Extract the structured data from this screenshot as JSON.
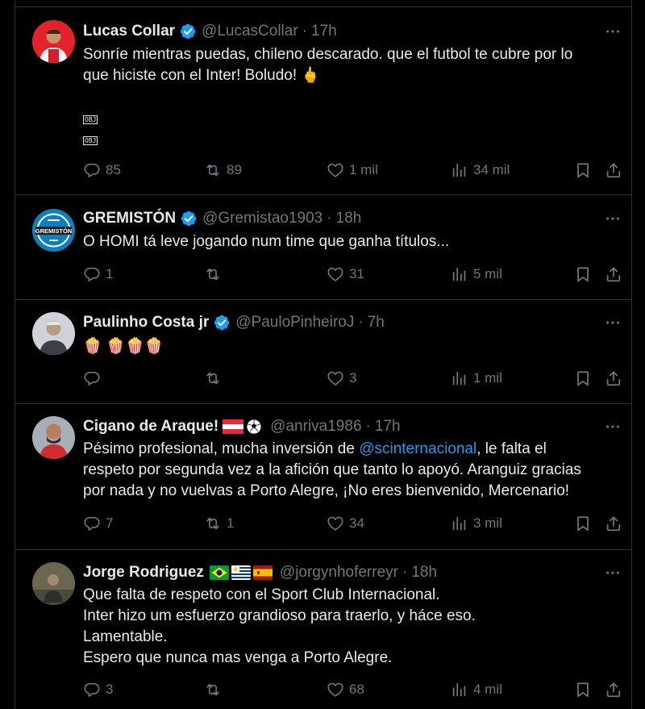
{
  "tweets": [
    {
      "name": "Lucas Collar",
      "handle": "@LucasCollar",
      "time": "17h",
      "lines": [
        "Sonríe mientras puedas, chileno descarado. que el futbol te cubre por lo",
        "que hiciste con el Inter! Boludo! 🖕"
      ],
      "obj_markers": [
        "OBJ",
        "OBJ"
      ],
      "replies": "85",
      "retweets": "89",
      "likes": "1 mil",
      "views": "34 mil"
    },
    {
      "name": "GREMISTÓN",
      "handle": "@Gremistao1903",
      "time": "18h",
      "avatar_text": "GREMISTÓN",
      "lines": [
        "O HOMI tá leve jogando num time que ganha títulos..."
      ],
      "replies": "1",
      "retweets": "",
      "likes": "31",
      "views": "5 mil"
    },
    {
      "name": "Paulinho Costa jr",
      "handle": "@PauloPinheiroJ",
      "time": "7h",
      "lines": [
        "🍿 🍿🍿🍿"
      ],
      "replies": "",
      "retweets": "",
      "likes": "3",
      "views": "1 mil"
    },
    {
      "name": "Cigano de Araque!",
      "handle": "@anriva1986",
      "time": "17h",
      "line1_before": "Pésimo profesional, mucha inversión de ",
      "mention": "@scinternacional",
      "line1_after": ", le falta el",
      "lines": [
        "respeto por segunda vez a la afición que tanto lo apoyó. Aranguiz gracias",
        "por nada y no vuelvas a Porto Alegre, ¡No eres bienvenido, Mercenario!"
      ],
      "replies": "7",
      "retweets": "1",
      "likes": "34",
      "views": "3 mil"
    },
    {
      "name": "Jorge Rodriguez",
      "handle": "@jorgynhoferreyr",
      "time": "18h",
      "lines": [
        "Que falta de respeto con el Sport Club Internacional.",
        "Inter hizo um esfuerzo grandioso para traerlo, y háce eso.",
        "Lamentable.",
        "Espero que nunca mas venga a Porto Alegre."
      ],
      "replies": "3",
      "retweets": "",
      "likes": "68",
      "views": "4 mil"
    }
  ],
  "colors": {
    "background": "#000000",
    "text": "#e7e9ea",
    "muted": "#71767b",
    "link": "#1d9bf0",
    "verified": "#1d9bf0",
    "divider": "#2f3336"
  },
  "icons": [
    "verified-badge-icon",
    "more-icon",
    "reply-icon",
    "retweet-icon",
    "like-icon",
    "views-icon",
    "bookmark-icon",
    "share-icon"
  ]
}
